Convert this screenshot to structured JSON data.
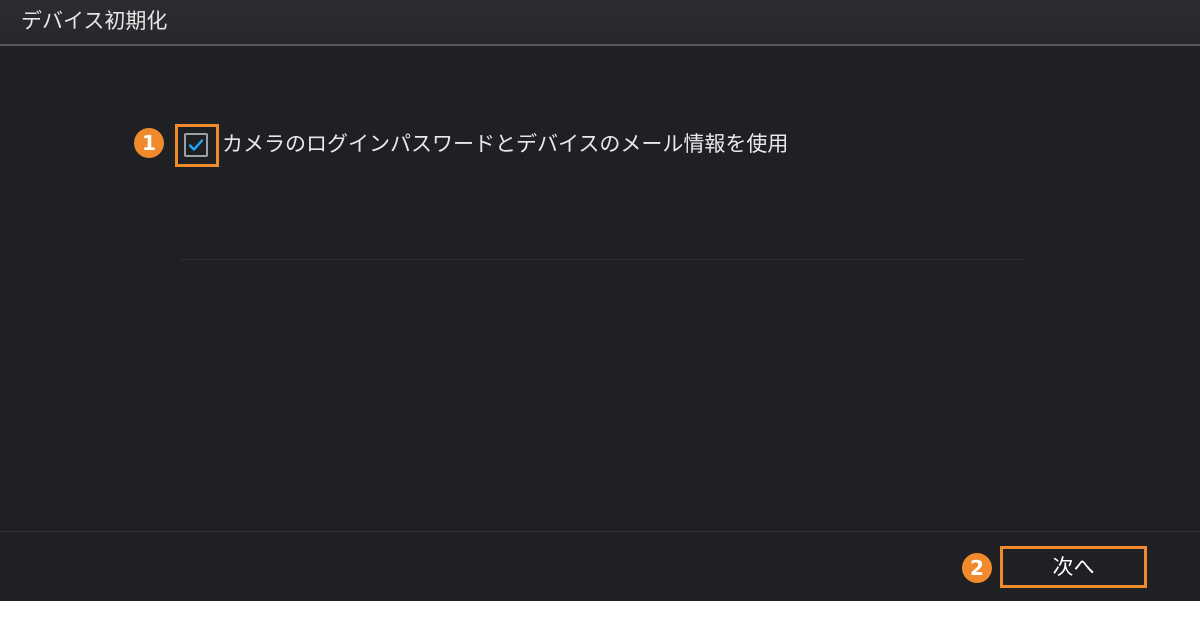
{
  "dialog": {
    "title": "デバイス初期化"
  },
  "option": {
    "checkbox_checked": true,
    "label": "カメラのログインパスワードとデバイスのメール情報を使用",
    "check_color": "#1ea7ff"
  },
  "footer": {
    "next_label": "次へ"
  },
  "annotations": {
    "step1": "1",
    "step2": "2",
    "highlight_color": "#f08a2c"
  }
}
